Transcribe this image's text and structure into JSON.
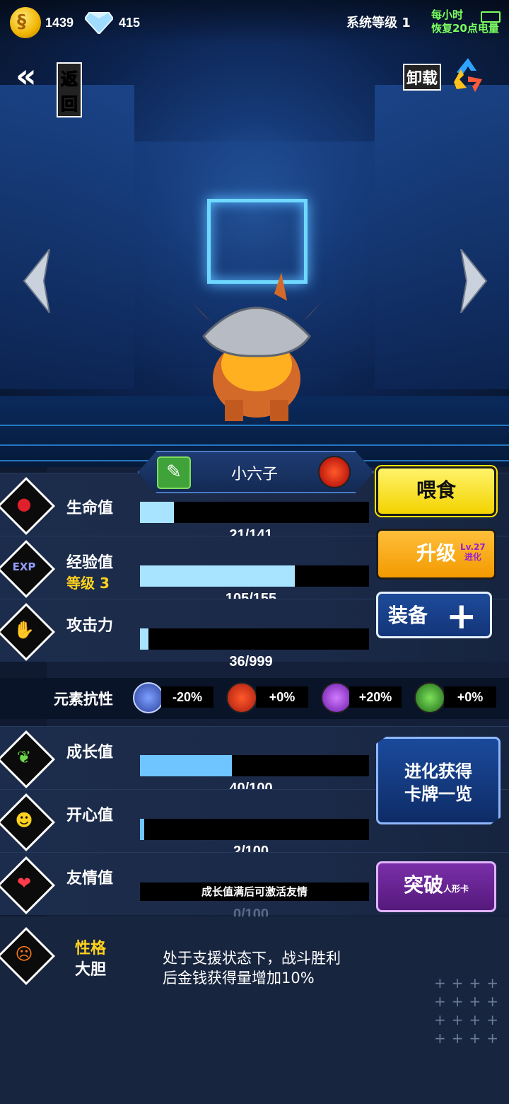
{
  "hud": {
    "coins": "1439",
    "gems": "415",
    "system_level": "系统等级 1",
    "energy_line1": "每小时",
    "energy_line2": "恢复20点电量"
  },
  "nav": {
    "back_label": "返回",
    "unload_label": "卸载"
  },
  "pet": {
    "name": "小六子",
    "element_icon": "fire-element-icon"
  },
  "stats": {
    "hp": {
      "label": "生命值",
      "current": 21,
      "max": 141,
      "text": "21/141",
      "fill": 0.149
    },
    "exp": {
      "label": "经验值",
      "level": "等级 3",
      "current": 105,
      "max": 155,
      "text": "105/155",
      "fill": 0.677
    },
    "atk": {
      "label": "攻击力",
      "current": 36,
      "max": 999,
      "text": "36/999",
      "fill": 0.036
    }
  },
  "elements": {
    "title": "元素抗性",
    "items": [
      {
        "icon": "light-element-icon",
        "value": "-20%",
        "color": "#3b66d8"
      },
      {
        "icon": "fire-element-icon",
        "value": "+0%",
        "color": "#d92a1a"
      },
      {
        "icon": "thunder-element-icon",
        "value": "+20%",
        "color": "#9b2fe0"
      },
      {
        "icon": "poison-element-icon",
        "value": "+0%",
        "color": "#3aa634"
      }
    ]
  },
  "growth": {
    "growth": {
      "label": "成长值",
      "current": 40,
      "max": 100,
      "text": "40/100",
      "fill": 0.4
    },
    "happy": {
      "label": "开心值",
      "current": 2,
      "max": 100,
      "text": "2/100",
      "fill": 0.02
    },
    "friend": {
      "label": "友情值",
      "note": "成长值满后可激活友情",
      "current": 0,
      "max": 100,
      "text": "0/100"
    }
  },
  "buttons": {
    "feed": "喂食",
    "upgrade": "升级",
    "upgrade_lv": "Lv.27",
    "upgrade_evo": "进化",
    "equip": "装备",
    "evo_line1": "进化获得",
    "evo_line2": "卡牌一览",
    "breakthrough": "突破",
    "breakthrough_sub": "人形卡"
  },
  "personality": {
    "title": "性格",
    "value": "大胆",
    "desc_line1": "处于支援状态下，战斗胜利",
    "desc_line2": "后金钱获得量增加10%"
  }
}
